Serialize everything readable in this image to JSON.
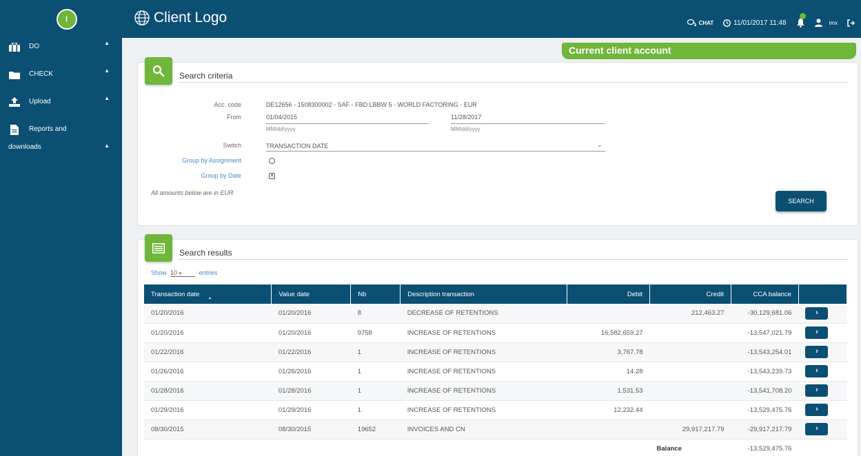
{
  "sidebar": {
    "avatar_initial": "I",
    "items": [
      {
        "label": "DO",
        "icon": "briefcase-icon"
      },
      {
        "label": "CHECK",
        "icon": "folder-icon"
      },
      {
        "label": "Upload",
        "icon": "upload-icon"
      },
      {
        "label": "Reports and",
        "label2": "downloads",
        "icon": "document-icon"
      }
    ]
  },
  "header": {
    "logo_text": "Client Logo",
    "chat_label": "CHAT",
    "datetime": "11/01/2017 11:48",
    "user": "imx"
  },
  "client_tab": "Current client account",
  "search": {
    "title": "Search criteria",
    "acc_code_label": "Acc. code",
    "acc_code_value": "DE12656 - 1508300002 - SAF - FBD LBBW 5 - WORLD FACTORING - EUR",
    "from_label": "From",
    "from_value": "01/04/2015",
    "to_value": "11/28/2017",
    "date_hint": "MM/dd/yyyy",
    "switch_label": "Switch",
    "switch_value": "TRANSACTION DATE",
    "group_assignment_label": "Group by Assignment",
    "group_date_label": "Group by Date",
    "note": "All amounts below are in EUR",
    "button": "SEARCH"
  },
  "results": {
    "title": "Search results",
    "show_label": "Show",
    "show_value": "10",
    "entries_label": "entries",
    "columns": [
      "Transaction date",
      "Value date",
      "Nb",
      "Description transaction",
      "Debit",
      "Credit",
      "CCA balance"
    ],
    "rows": [
      [
        "01/20/2016",
        "01/20/2016",
        "8",
        "DECREASE OF RETENTIONS",
        "",
        "212,463.27",
        "-30,129,681.06"
      ],
      [
        "01/20/2016",
        "01/20/2016",
        "9758",
        "INCREASE OF RETENTIONS",
        "16,582,659.27",
        "",
        "-13,547,021.79"
      ],
      [
        "01/22/2016",
        "01/22/2016",
        "1",
        "INCREASE OF RETENTIONS",
        "3,767.78",
        "",
        "-13,543,254.01"
      ],
      [
        "01/26/2016",
        "01/26/2016",
        "1",
        "INCREASE OF RETENTIONS",
        "14.28",
        "",
        "-13,543,239.73"
      ],
      [
        "01/28/2016",
        "01/28/2016",
        "1",
        "INCREASE OF RETENTIONS",
        "1,531.53",
        "",
        "-13,541,708.20"
      ],
      [
        "01/29/2016",
        "01/29/2016",
        "1",
        "INCREASE OF RETENTIONS",
        "12,232.44",
        "",
        "-13,529,475.76"
      ],
      [
        "08/30/2015",
        "08/30/2015",
        "19652",
        "INVOICES AND CN",
        "",
        "29,917,217.79",
        "-29,917,217.79"
      ]
    ],
    "balance_label": "Balance",
    "balance_value": "-13,529,475.76"
  },
  "colors": {
    "primary": "#0b4f73",
    "accent": "#6fb63b"
  }
}
